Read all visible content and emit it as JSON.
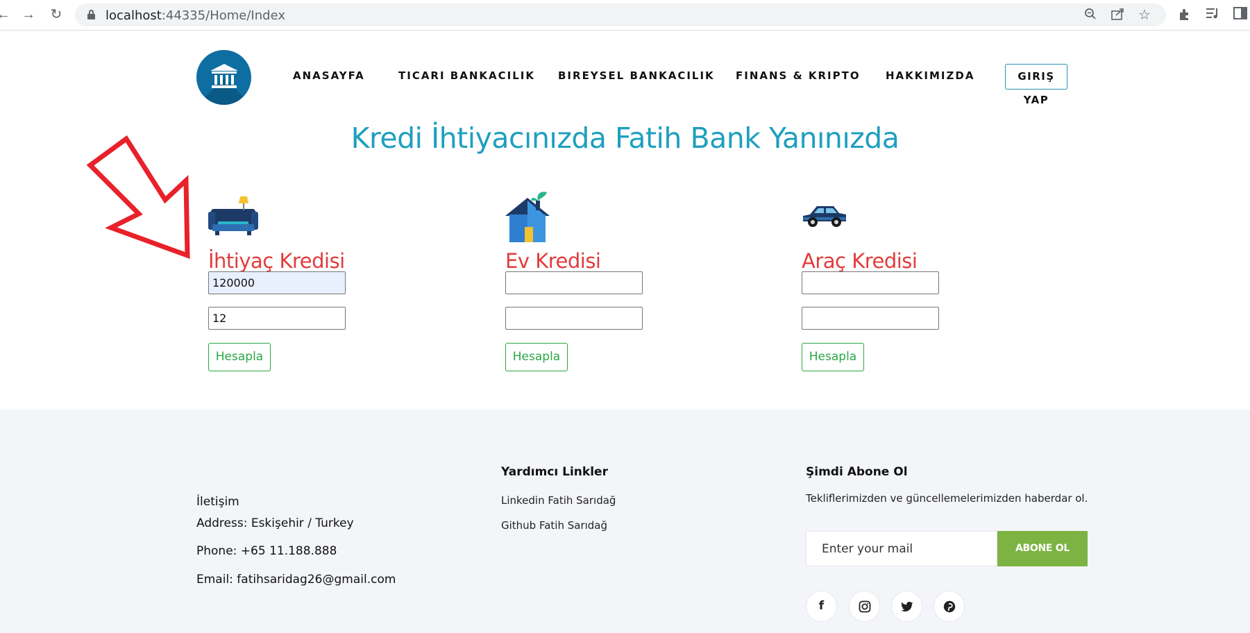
{
  "browser": {
    "url_host": "localhost",
    "url_rest": ":44335/Home/Index",
    "back_icon": "arrow-left-icon",
    "forward_icon": "arrow-right-icon",
    "reload_icon": "reload-icon"
  },
  "header": {
    "menu": [
      "ANASAYFA",
      "TICARI BANKACILIK",
      "BIREYSEL BANKACILIK",
      "FINANS & KRIPTO",
      "HAKKIMIZDA"
    ],
    "login_label": "GIRIŞ YAP"
  },
  "hero": {
    "title": "Kredi İhtiyacınızda Fatih Bank Yanınızda"
  },
  "credits": [
    {
      "title": "İhtiyaç Kredisi",
      "amount": "120000",
      "term": "12",
      "button": "Hesapla",
      "icon": "sofa-icon"
    },
    {
      "title": "Ev Kredisi",
      "amount": "",
      "term": "",
      "button": "Hesapla",
      "icon": "house-icon"
    },
    {
      "title": "Araç Kredisi",
      "amount": "",
      "term": "",
      "button": "Hesapla",
      "icon": "car-icon"
    }
  ],
  "footer": {
    "contact": {
      "heading": "İletişim",
      "address": "Address: Eskişehir / Turkey",
      "phone": "Phone: +65 11.188.888",
      "email": "Email: fatihsaridag26@gmail.com"
    },
    "links": {
      "heading": "Yardımcı Linkler",
      "items": [
        "Linkedin Fatih Sarıdağ",
        "Github Fatih Sarıdağ"
      ]
    },
    "subscribe": {
      "heading": "Şimdi Abone Ol",
      "text": "Tekliflerimizden ve güncellemelerimizden haberdar ol.",
      "placeholder": "Enter your mail",
      "button": "ABONE OL"
    },
    "social": [
      "facebook-icon",
      "instagram-icon",
      "twitter-icon",
      "pinterest-icon"
    ]
  },
  "colors": {
    "accent": "#1e9fbf",
    "credit_title": "#e23b3b",
    "button_green": "#28a745",
    "subscribe_green": "#7cb342",
    "footer_bg": "#f3f5f9",
    "annotation_arrow": "#e8212a"
  }
}
